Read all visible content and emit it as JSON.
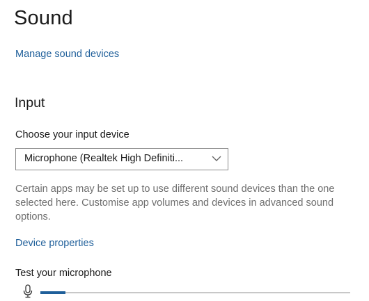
{
  "page": {
    "title": "Sound",
    "manage_link": "Manage sound devices"
  },
  "input": {
    "heading": "Input",
    "choose_label": "Choose your input device",
    "selected_device": "Microphone (Realtek High Definiti...",
    "help_text": "Certain apps may be set up to use different sound devices than the one selected here. Customise app volumes and devices in advanced sound options.",
    "device_properties_link": "Device properties",
    "test_label": "Test your microphone",
    "mic_level_fraction": 0.08
  },
  "icons": {
    "dropdown": "chevron-down-icon",
    "microphone": "microphone-icon"
  },
  "colors": {
    "accent": "#1f5f9a",
    "secondary_text": "#6e6e6e",
    "track": "#c8c8c8"
  }
}
